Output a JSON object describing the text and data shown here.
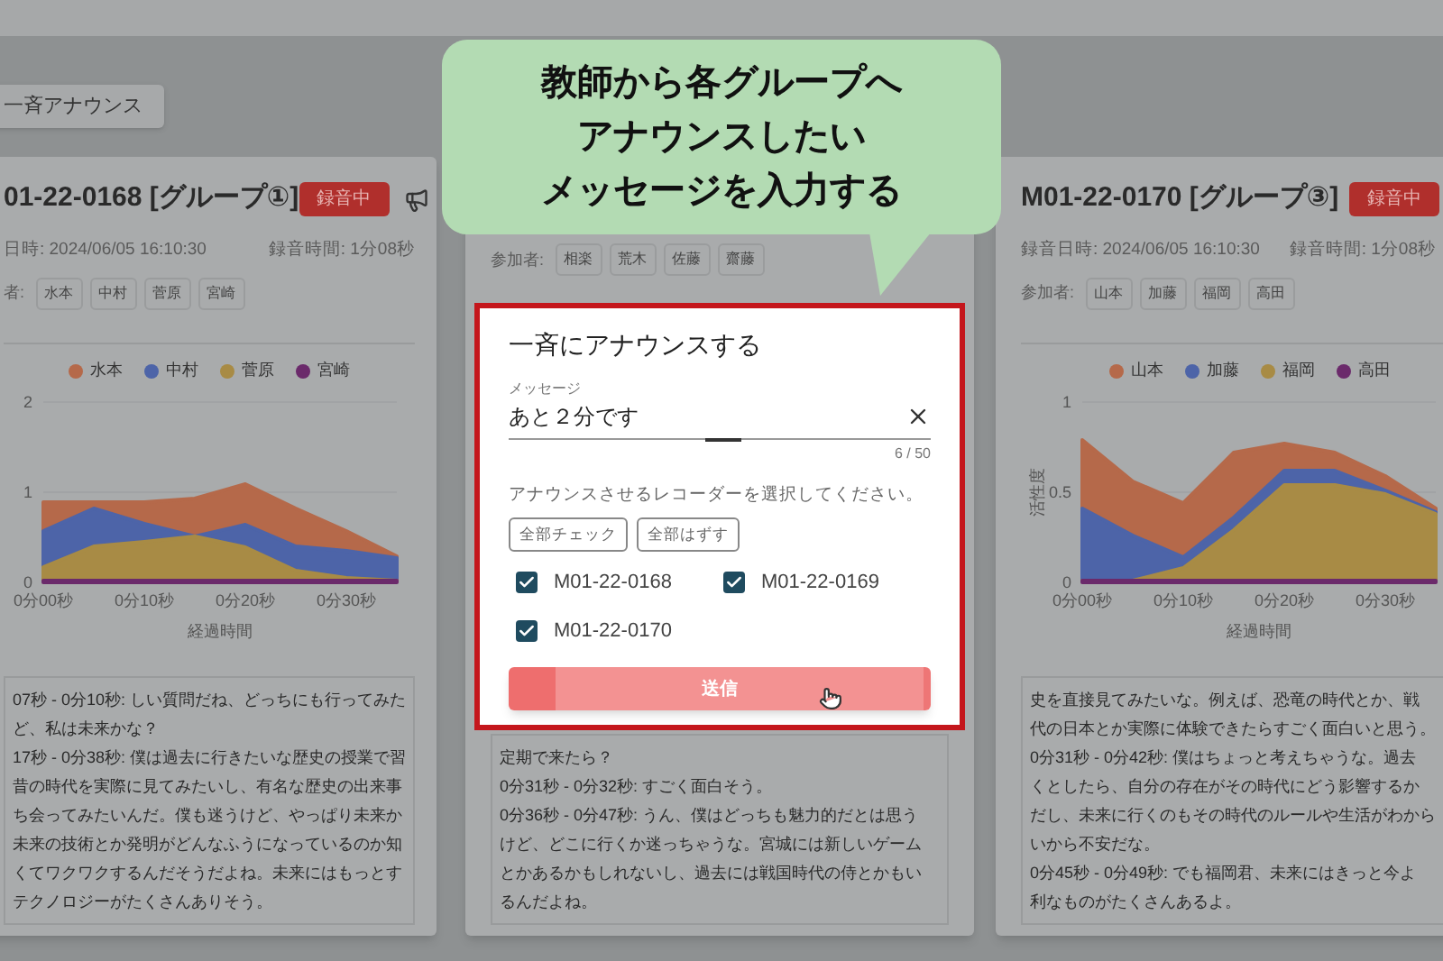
{
  "announce_button": "一斉アナウンス",
  "recorders": [
    {
      "title": "01-22-0168 [グループ①]",
      "badge": "録音中",
      "date": "日時: 2024/06/05 16:10:30",
      "duration": "録音時間: 1分08秒",
      "participants_label": "者:",
      "participants": [
        "水本",
        "中村",
        "菅原",
        "宮崎"
      ],
      "chart_data": {
        "type": "area",
        "stacked": true,
        "xlabel": "経過時間",
        "categories": [
          "0分00秒",
          null,
          "0分10秒",
          null,
          "0分20秒",
          null,
          "0分30秒",
          null
        ],
        "ylim": [
          0,
          2
        ],
        "yticks": [
          0,
          1,
          2
        ],
        "series": [
          {
            "name": "宮崎",
            "color": "#6b2a6b",
            "values": [
              0.02,
              0.02,
              0.02,
              0.02,
              0.02,
              0.02,
              0.02,
              0.02
            ]
          },
          {
            "name": "菅原",
            "color": "#a88b45",
            "values": [
              0.15,
              0.38,
              0.43,
              0.49,
              0.37,
              0.11,
              0.03,
              0
            ]
          },
          {
            "name": "中村",
            "color": "#4d64a8",
            "values": [
              0.4,
              0.42,
              0.2,
              0,
              0.25,
              0.27,
              0.3,
              0.25
            ]
          },
          {
            "name": "水本",
            "color": "#b5694a",
            "values": [
              0.32,
              0.07,
              0.24,
              0.42,
              0.45,
              0.42,
              0.22,
              0.02
            ]
          }
        ]
      },
      "transcript": [
        "07秒 - 0分10秒: しい質問だね、どっちにも行ってみた",
        "ど、私は未来かな？",
        "17秒 - 0分38秒: 僕は過去に行きたいな歴史の授業で習",
        "昔の時代を実際に見てみたいし、有名な歴史の出来事",
        "ち会ってみたいんだ。僕も迷うけど、やっぱり未来か",
        "未来の技術とか発明がどんなふうになっているのか知",
        "くてワクワクするんだそうだよね。未来にはもっとす",
        "テクノロジーがたくさんありそう。"
      ]
    },
    {
      "participants_label": "参加者:",
      "participants": [
        "相楽",
        "荒木",
        "佐藤",
        "齋藤"
      ],
      "transcript": [
        "定期で来たら？",
        "0分31秒 - 0分32秒: すごく面白そう。",
        "0分36秒 - 0分47秒: うん、僕はどっちも魅力的だとは思う",
        "けど、どこに行くか迷っちゃうな。宮城には新しいゲーム",
        "とかあるかもしれないし、過去には戦国時代の侍とかもい",
        "るんだよね。"
      ]
    },
    {
      "title": "M01-22-0170 [グループ③]",
      "badge": "録音中",
      "date": "録音日時: 2024/06/05 16:10:30",
      "duration": "録音時間: 1分08秒",
      "participants_label": "参加者:",
      "participants": [
        "山本",
        "加藤",
        "福岡",
        "高田"
      ],
      "chart_data": {
        "type": "area",
        "stacked": true,
        "xlabel": "経過時間",
        "ylabel": "活性度",
        "categories": [
          "0分00秒",
          null,
          "0分10秒",
          null,
          "0分20秒",
          null,
          "0分30秒",
          null
        ],
        "ylim": [
          0,
          1
        ],
        "yticks": [
          0,
          0.5,
          1
        ],
        "series": [
          {
            "name": "高田",
            "color": "#6b2a6b",
            "values": [
              0.01,
              0.01,
              0.01,
              0.01,
              0.01,
              0.01,
              0.01,
              0.01
            ]
          },
          {
            "name": "福岡",
            "color": "#a88b45",
            "values": [
              0,
              0,
              0.07,
              0.28,
              0.53,
              0.53,
              0.48,
              0.37
            ]
          },
          {
            "name": "加藤",
            "color": "#4d64a8",
            "values": [
              0.4,
              0.25,
              0.06,
              0.07,
              0.08,
              0.08,
              0.02,
              0.01
            ]
          },
          {
            "name": "山本",
            "color": "#b5694a",
            "values": [
              0.38,
              0.3,
              0.3,
              0.36,
              0.15,
              0.1,
              0.08,
              0.02
            ]
          }
        ]
      },
      "transcript": [
        "史を直接見てみたいな。例えば、恐竜の時代とか、戦",
        "代の日本とか実際に体験できたらすごく面白いと思う。",
        "0分31秒 - 0分42秒: 僕はちょっと考えちゃうな。過去",
        "くとしたら、自分の存在がその時代にどう影響するか",
        "だし、未来に行くのもその時代のルールや生活がわから",
        "いから不安だな。",
        "0分45秒 - 0分49秒: でも福岡君、未来にはきっと今よ",
        "利なものがたくさんあるよ。"
      ]
    }
  ],
  "modal": {
    "title": "一斉にアナウンスする",
    "message_label": "メッセージ",
    "message_value": "あと２分です",
    "counter": "6 / 50",
    "instruction": "アナウンスさせるレコーダーを選択してください。",
    "check_all": "全部チェック",
    "uncheck_all": "全部はずす",
    "recorders": [
      {
        "label": "M01-22-0168",
        "checked": true
      },
      {
        "label": "M01-22-0169",
        "checked": true
      },
      {
        "label": "M01-22-0170",
        "checked": true
      }
    ],
    "send": "送信"
  },
  "callout": {
    "lines": [
      "教師から各グループへ",
      "アナウンスしたい",
      "メッセージを入力する"
    ]
  }
}
